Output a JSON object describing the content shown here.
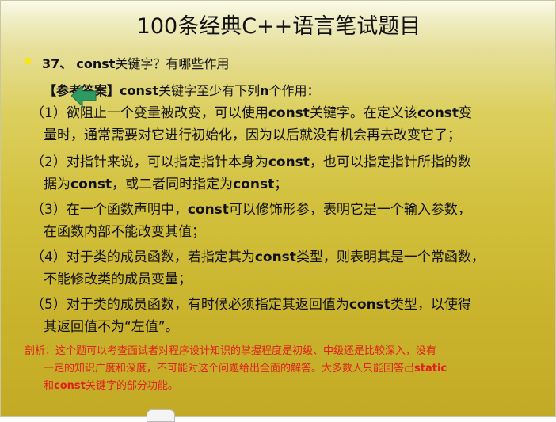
{
  "slide": {
    "title": "100条经典C++语言笔试题目",
    "question": {
      "number": "37、",
      "keyword": "const",
      "text": "关键字？有哪些作用"
    },
    "answer_intro": {
      "label": "【参考答案】",
      "keyword": "const",
      "text_mid": "关键字至少有下列",
      "n": "n",
      "text_end": "个作用："
    },
    "items": [
      {
        "lines": [
          [
            "（1）欲阻止一个变量被改变，可以使用",
            "const",
            "关键字。在定义该",
            "const",
            "变"
          ],
          [
            "量时，通常需要对它进行初始化，因为以后就没有机会再去改变它了；"
          ]
        ]
      },
      {
        "lines": [
          [
            "（2）对指针来说，可以指定指针本身为",
            "const",
            "，也可以指定指针所指的数"
          ],
          [
            "据为",
            "const",
            "，或二者同时指定为",
            "const",
            "；"
          ]
        ]
      },
      {
        "lines": [
          [
            "（3）在一个函数声明中，",
            "const",
            "可以修饰形参，表明它是一个输入参数，"
          ],
          [
            "在函数内部不能改变其值；"
          ]
        ]
      },
      {
        "lines": [
          [
            "（4）对于类的成员函数，若指定其为",
            "const",
            "类型，则表明其是一个常函数，"
          ],
          [
            "不能修改类的成员变量；"
          ]
        ]
      },
      {
        "lines": [
          [
            "（5）对于类的成员函数，有时候必须指定其返回值为",
            "const",
            "类型，以使得"
          ],
          [
            "其返回值不为“左值”。"
          ]
        ]
      }
    ],
    "analysis": {
      "lines": [
        [
          "剖析：这个题可以考查面试者对程序设计知识的掌握程度是初级、中级还是比较深入，没有"
        ],
        [
          "一定的知识广度和深度，不可能对这个问题给出全面的解答。大多数人只能回答出",
          "static"
        ],
        [
          "和",
          "const",
          "关键字的部分功能。"
        ]
      ]
    },
    "colors": {
      "bullet": "#f6e51a",
      "arrow": "#2e9a63",
      "analysis_text": "#e0211b"
    },
    "icons": {
      "arrow": "left-arrow-icon"
    }
  }
}
